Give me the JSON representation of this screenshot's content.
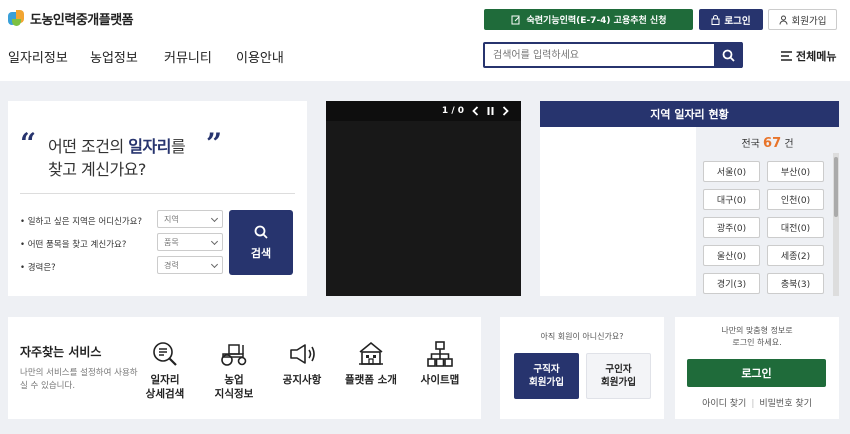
{
  "header": {
    "logo_text": "도농인력중개플랫폼",
    "recommend_button": "숙련기능인력(E-7-4) 고용추천 신청",
    "login_button": "로그인",
    "join_button": "회원가입"
  },
  "nav": {
    "items": [
      "일자리정보",
      "농업정보",
      "커뮤니티",
      "이용안내"
    ],
    "search_placeholder": "검색어를 입력하세요",
    "all_menu": "전체메뉴"
  },
  "job_search": {
    "line1_prefix": "어떤 조건의 ",
    "line1_highlight": "일자리",
    "line1_suffix": "를",
    "line2": "찾고 계신가요?",
    "questions": [
      {
        "label": "• 일하고 싶은 지역은 어디신가요?",
        "select": "지역"
      },
      {
        "label": "• 어떤 품목을 찾고 계신가요?",
        "select": "품목"
      },
      {
        "label": "• 경력은?",
        "select": "경력"
      }
    ],
    "search_button": "검색"
  },
  "media": {
    "counter": "1 / 0"
  },
  "region": {
    "title": "지역 일자리 현황",
    "total_prefix": "전국 ",
    "total_count": "67",
    "total_suffix": " 건",
    "items": [
      "서울(0)",
      "부산(0)",
      "대구(0)",
      "인천(0)",
      "광주(0)",
      "대전(0)",
      "울산(0)",
      "세종(2)",
      "경기(3)",
      "충북(3)"
    ]
  },
  "favorites": {
    "title": "자주찾는 서비스",
    "desc": "나만의 서비스를 설정하여 사용하실 수 있습니다.",
    "items": [
      {
        "line1": "일자리",
        "line2": "상세검색",
        "icon": "magnifier-doc-icon"
      },
      {
        "line1": "농업",
        "line2": "지식정보",
        "icon": "tractor-icon"
      },
      {
        "line1": "공지사항",
        "line2": "",
        "icon": "megaphone-icon"
      },
      {
        "line1": "플랫폼 소개",
        "line2": "",
        "icon": "building-icon"
      },
      {
        "line1": "사이트맵",
        "line2": "",
        "icon": "sitemap-icon"
      }
    ]
  },
  "member": {
    "question": "아직 회원이 아니신가요?",
    "seeker_line1": "구직자",
    "seeker_line2": "회원가입",
    "employer_line1": "구인자",
    "employer_line2": "회원가입"
  },
  "login_box": {
    "msg_line1": "나만의 맞춤형 정보로",
    "msg_line2": "로그인 하세요.",
    "button": "로그인",
    "find_id": "아이디 찾기",
    "find_pw": "비밀번호 찾기"
  },
  "colors": {
    "navy": "#27346e",
    "green": "#1f6b3a",
    "accent_orange": "#e8742a"
  }
}
